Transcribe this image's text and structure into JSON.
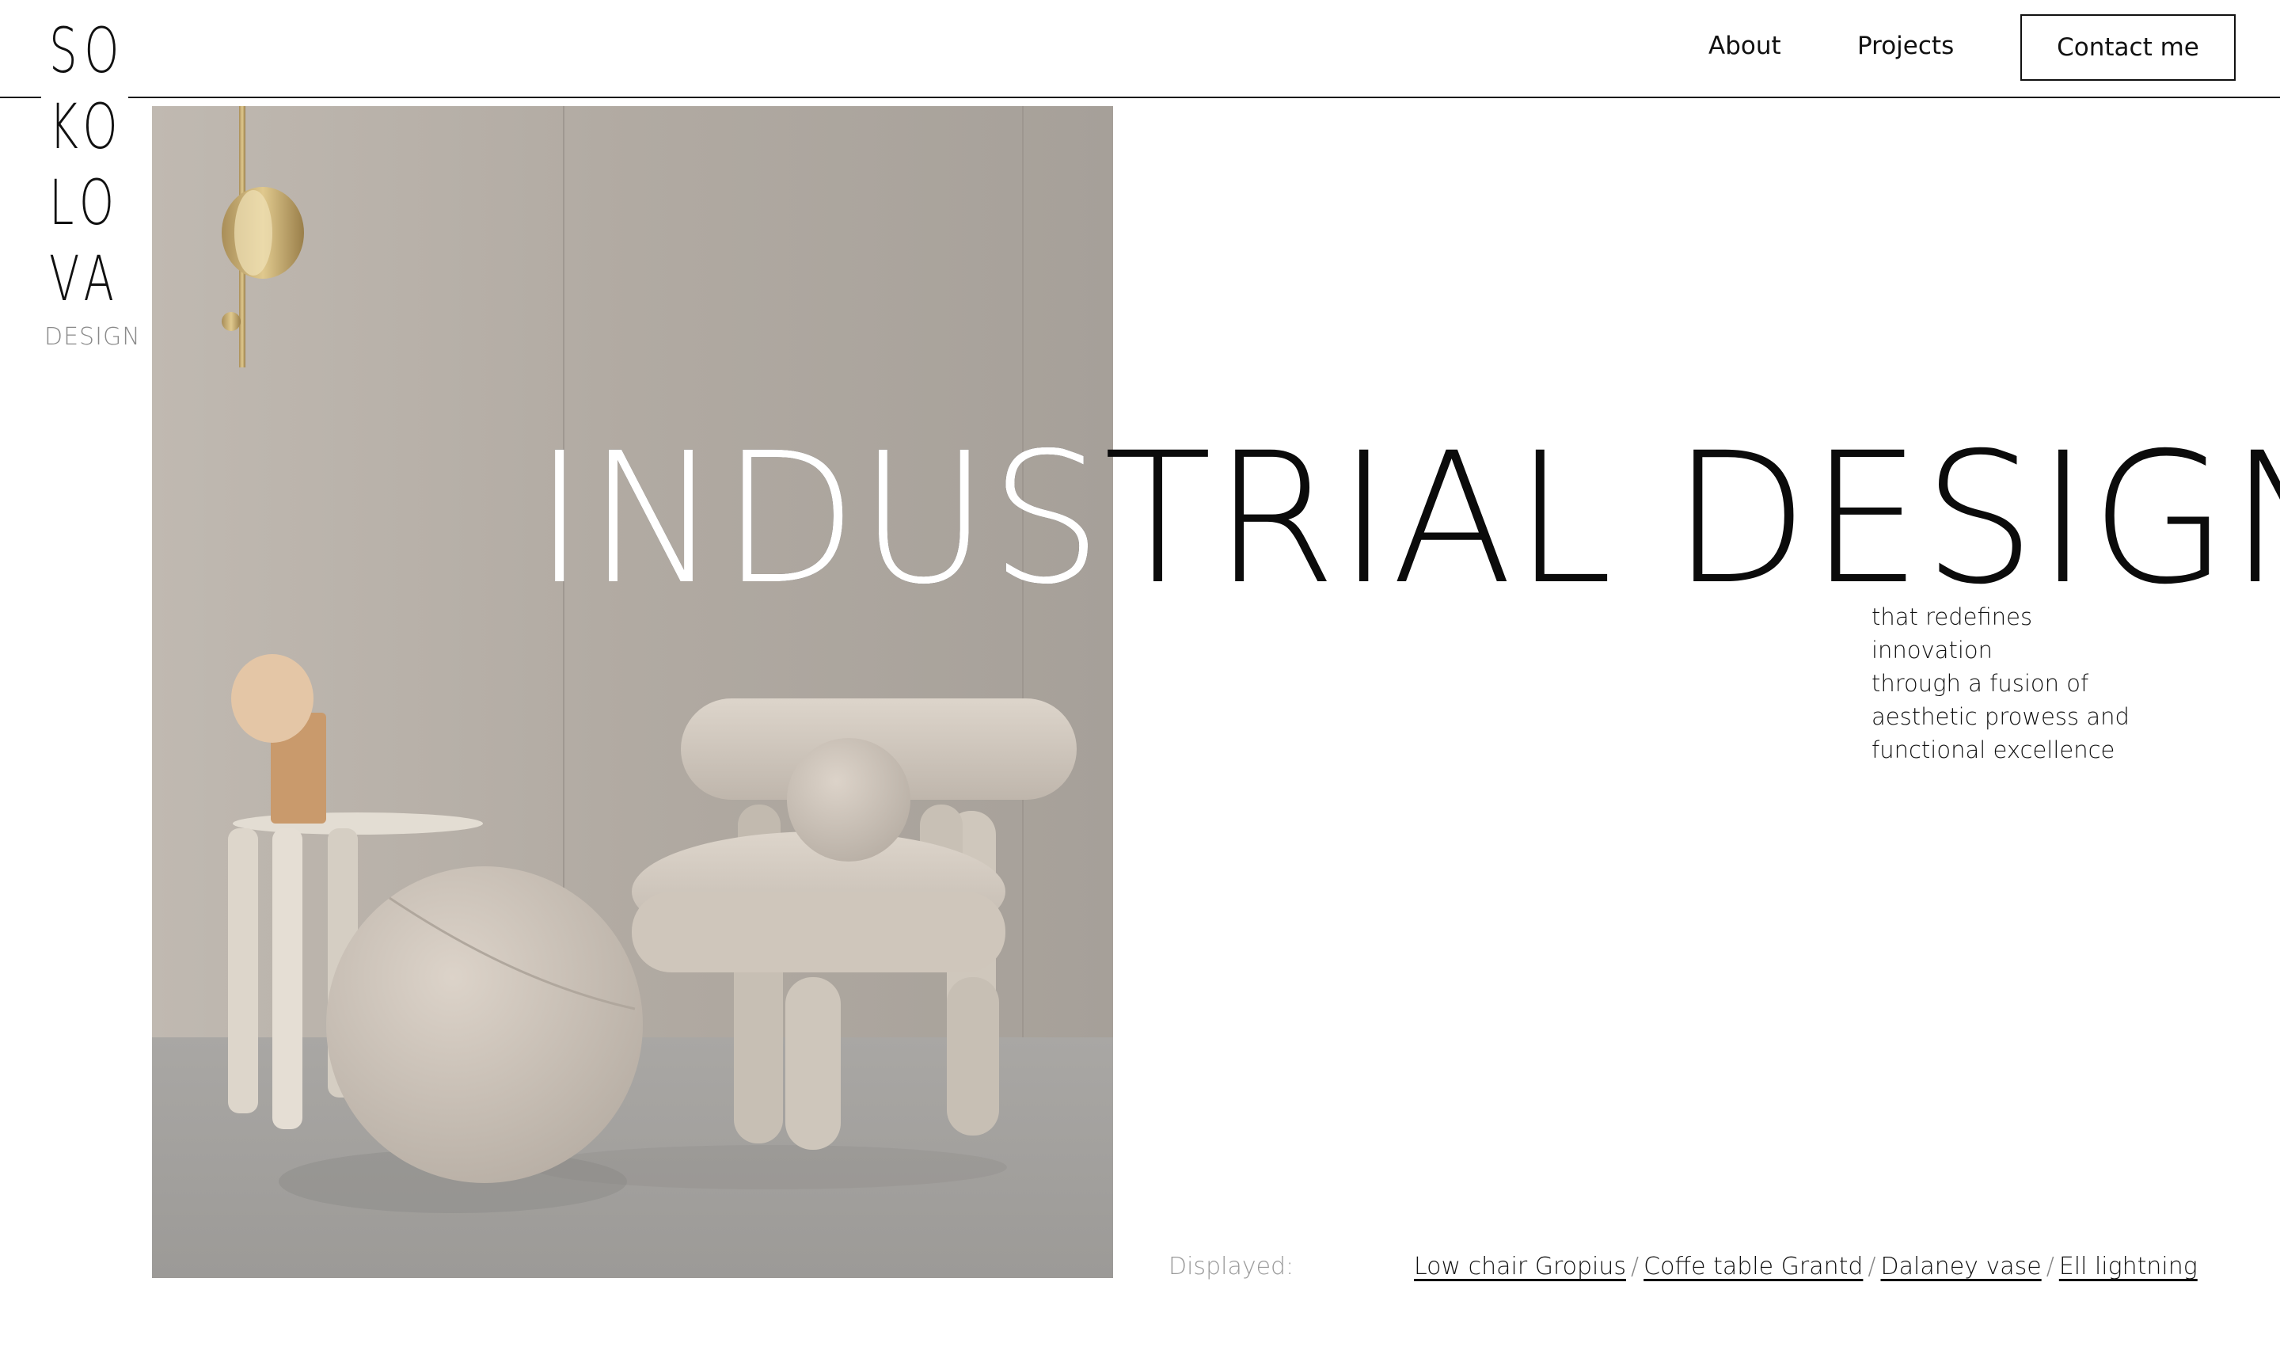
{
  "brand": {
    "logo_rows": [
      "SO",
      "KO",
      "LO",
      "VA"
    ],
    "logo_sub": "DESIGN"
  },
  "nav": {
    "about": "About",
    "projects": "Projects",
    "contact": "Contact me"
  },
  "hero": {
    "headline": "INDUSTRIAL DESIGN",
    "tagline_lines": [
      "that redefines innovation",
      "through a fusion of",
      "aesthetic prowess and",
      "functional excellence"
    ]
  },
  "displayed": {
    "label": "Displayed:",
    "items": [
      "Low chair Gropius",
      "Coffe table Grantd",
      "Dalaney vase",
      "Ell lightning"
    ],
    "separator": "/"
  },
  "colors": {
    "text": "#111111",
    "muted": "#9a9a9a",
    "background": "#ffffff",
    "photo_wall": "#b3aca4",
    "photo_fabric": "#d8d0c6"
  },
  "icons": []
}
